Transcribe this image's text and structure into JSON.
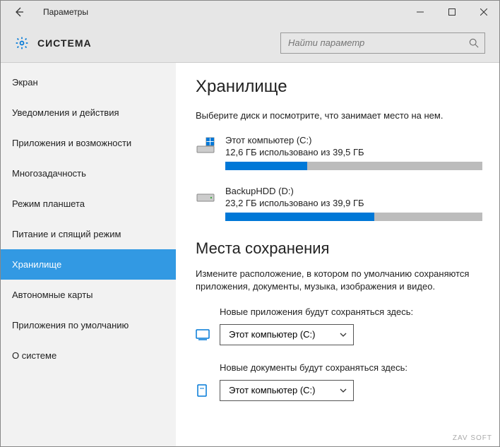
{
  "window": {
    "title": "Параметры"
  },
  "header": {
    "title": "СИСТЕМА",
    "search_placeholder": "Найти параметр"
  },
  "sidebar": {
    "items": [
      {
        "label": "Экран"
      },
      {
        "label": "Уведомления и действия"
      },
      {
        "label": "Приложения и возможности"
      },
      {
        "label": "Многозадачность"
      },
      {
        "label": "Режим планшета"
      },
      {
        "label": "Питание и спящий режим"
      },
      {
        "label": "Хранилище"
      },
      {
        "label": "Автономные карты"
      },
      {
        "label": "Приложения по умолчанию"
      },
      {
        "label": "О системе"
      }
    ],
    "active_index": 6
  },
  "main": {
    "storage_title": "Хранилище",
    "storage_desc": "Выберите диск и посмотрите, что занимает место на нем.",
    "drives": [
      {
        "name": "Этот компьютер (C:)",
        "used": "12,6 ГБ использовано из 39,5 ГБ",
        "percent": 32,
        "icon": "os"
      },
      {
        "name": "BackupHDD (D:)",
        "used": "23,2 ГБ использовано из 39,9 ГБ",
        "percent": 58,
        "icon": "hdd"
      }
    ],
    "save_title": "Места сохранения",
    "save_desc": "Измените расположение, в котором по умолчанию сохраняются приложения, документы, музыка, изображения и видео.",
    "apps_label": "Новые приложения будут сохраняться здесь:",
    "apps_value": "Этот компьютер (C:)",
    "docs_label": "Новые документы будут сохраняться здесь:",
    "docs_value": "Этот компьютер (C:)"
  },
  "watermark": "ZAV SOFT"
}
